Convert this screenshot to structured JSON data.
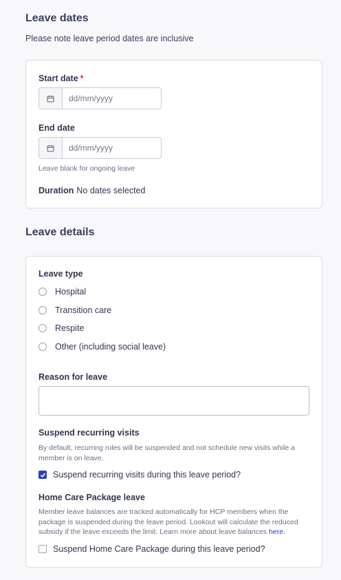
{
  "leave_dates": {
    "title": "Leave dates",
    "note": "Please note leave period dates are inclusive",
    "start_date": {
      "label": "Start date",
      "required_mark": "*",
      "placeholder": "dd/mm/yyyy"
    },
    "end_date": {
      "label": "End date",
      "placeholder": "dd/mm/yyyy",
      "hint": "Leave blank for ongoing leave"
    },
    "duration": {
      "label": "Duration",
      "value": "No dates selected"
    }
  },
  "leave_details": {
    "title": "Leave details",
    "leave_type": {
      "label": "Leave type",
      "options": [
        "Hospital",
        "Transition care",
        "Respite",
        "Other (including social leave)"
      ]
    },
    "reason": {
      "label": "Reason for leave",
      "value": ""
    },
    "suspend_visits": {
      "label": "Suspend recurring visits",
      "description": "By default, recurring rules will be suspended and not schedule new visits while a member is on leave.",
      "checkbox_label": "Suspend recurring visits during this leave period?",
      "checked": true
    },
    "hcp_leave": {
      "label": "Home Care Package leave",
      "description": "Member leave balances are tracked automatically for HCP members when the package is suspended during the leave period. Lookout will calculate the reduced subsidy if the leave exceeds the limit. Learn more about leave balances",
      "link_text": "here",
      "period": ".",
      "checkbox_label": "Suspend Home Care Package during this leave period?",
      "checked": false
    }
  },
  "colors": {
    "accent": "#2a3fbf",
    "required": "#d23a3a",
    "text": "#2f3550"
  },
  "icons": {
    "date_field": "calendar-icon",
    "checkbox_checked": "checkmark-icon"
  }
}
